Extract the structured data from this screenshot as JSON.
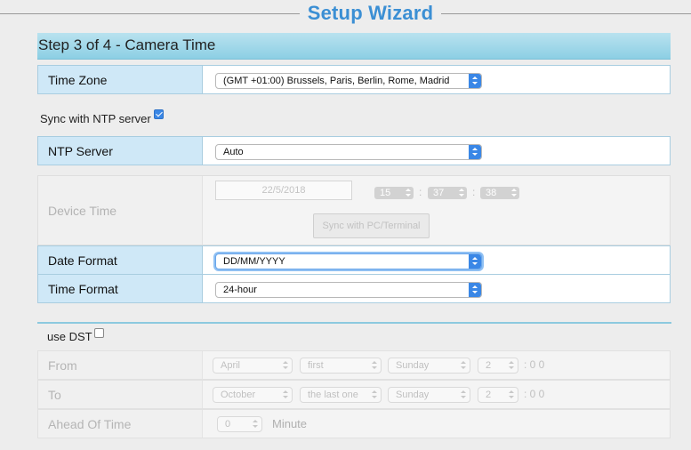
{
  "wizard": {
    "title": "Setup Wizard",
    "step_title": "Step 3 of 4 - Camera Time"
  },
  "time_zone": {
    "label": "Time Zone",
    "value": "(GMT +01:00) Brussels, Paris, Berlin, Rome, Madrid"
  },
  "sync_ntp": {
    "label": "Sync with NTP server",
    "checked": true
  },
  "ntp_server": {
    "label": "NTP Server",
    "value": "Auto"
  },
  "device_time": {
    "label": "Device Time",
    "date": "22/5/2018",
    "hour": "15",
    "minute": "37",
    "second": "38",
    "colon": ":",
    "sync_button": "Sync with PC/Terminal"
  },
  "date_format": {
    "label": "Date Format",
    "value": "DD/MM/YYYY"
  },
  "time_format": {
    "label": "Time Format",
    "value": "24-hour"
  },
  "dst": {
    "label": "use DST",
    "checked": false,
    "from": {
      "label": "From",
      "month": "April",
      "week": "first",
      "day": "Sunday",
      "hour": "2",
      "suffix": ": 0 0"
    },
    "to": {
      "label": "To",
      "month": "October",
      "week": "the last one",
      "day": "Sunday",
      "hour": "2",
      "suffix": ": 0 0"
    },
    "ahead": {
      "label": "Ahead Of Time",
      "value": "0",
      "unit": "Minute"
    }
  },
  "colors": {
    "title_blue": "#3b8fd4",
    "header_bar": "#8ccfe4",
    "label_bg": "#cfe8f7",
    "select_arrow": "#3a87e6"
  }
}
